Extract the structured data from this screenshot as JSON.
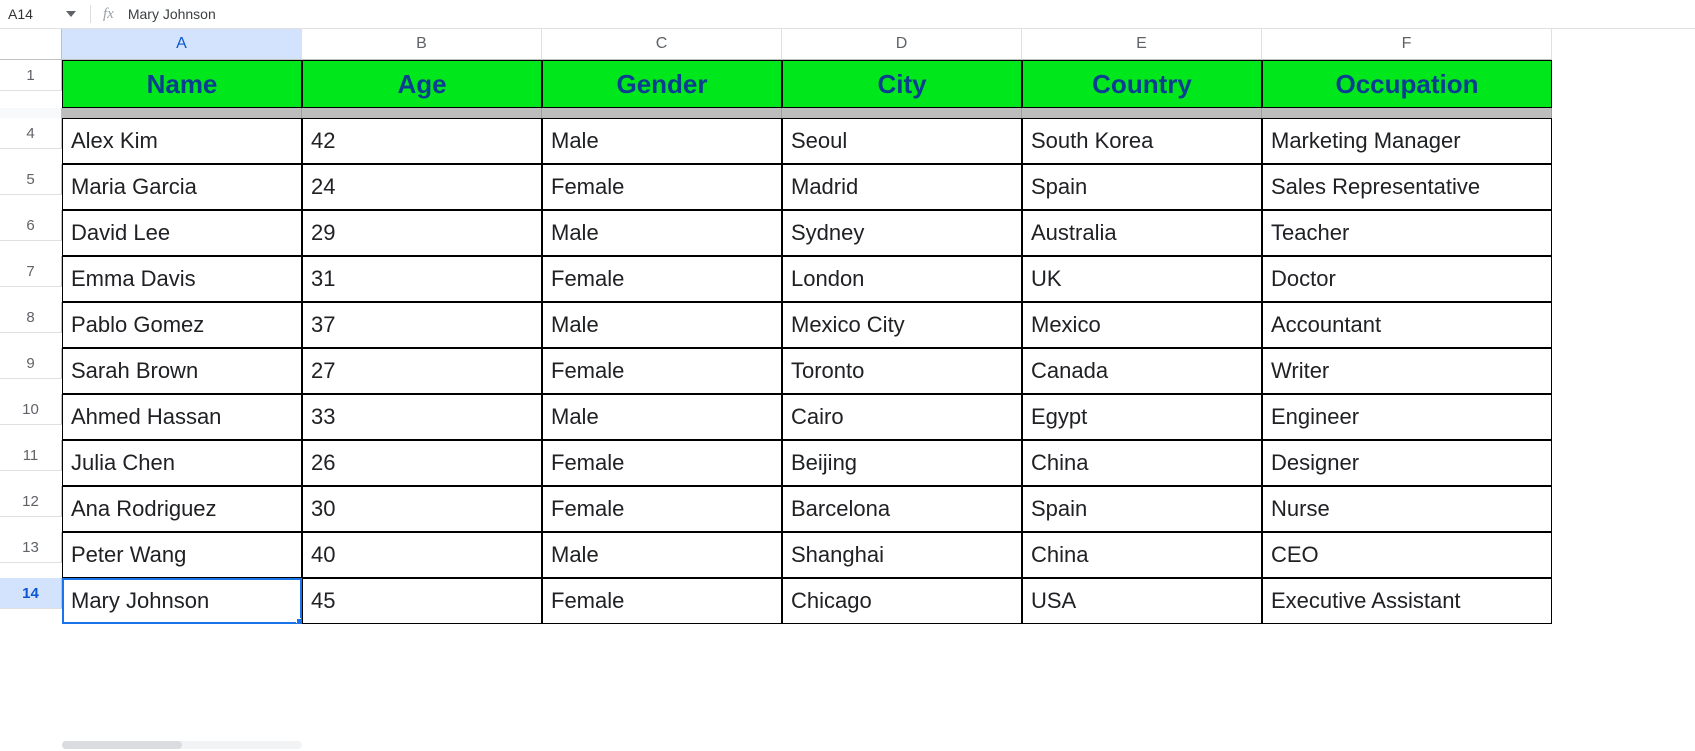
{
  "formula_bar": {
    "cell_ref": "A14",
    "fx_label": "fx",
    "content": "Mary Johnson"
  },
  "columns": [
    "A",
    "B",
    "C",
    "D",
    "E",
    "F"
  ],
  "active_column": "A",
  "active_row": "14",
  "row_numbers": [
    "1",
    "4",
    "5",
    "6",
    "7",
    "8",
    "9",
    "10",
    "11",
    "12",
    "13",
    "14"
  ],
  "table": {
    "headers": [
      "Name",
      "Age",
      "Gender",
      "City",
      "Country",
      "Occupation"
    ],
    "rows": [
      [
        "Alex Kim",
        "42",
        "Male",
        "Seoul",
        "South Korea",
        "Marketing Manager"
      ],
      [
        "Maria Garcia",
        "24",
        "Female",
        "Madrid",
        "Spain",
        "Sales Representative"
      ],
      [
        "David Lee",
        "29",
        "Male",
        "Sydney",
        "Australia",
        "Teacher"
      ],
      [
        "Emma Davis",
        "31",
        "Female",
        "London",
        "UK",
        "Doctor"
      ],
      [
        "Pablo Gomez",
        "37",
        "Male",
        "Mexico City",
        "Mexico",
        "Accountant"
      ],
      [
        "Sarah Brown",
        "27",
        "Female",
        "Toronto",
        "Canada",
        "Writer"
      ],
      [
        "Ahmed Hassan",
        "33",
        "Male",
        "Cairo",
        "Egypt",
        "Engineer"
      ],
      [
        "Julia Chen",
        "26",
        "Female",
        "Beijing",
        "China",
        "Designer"
      ],
      [
        "Ana Rodriguez",
        "30",
        "Female",
        "Barcelona",
        "Spain",
        "Nurse"
      ],
      [
        "Peter Wang",
        "40",
        "Male",
        "Shanghai",
        "China",
        "CEO"
      ],
      [
        "Mary Johnson",
        "45",
        "Female",
        "Chicago",
        "USA",
        "Executive Assistant"
      ]
    ]
  },
  "chart_data": {
    "type": "table",
    "columns": [
      "Name",
      "Age",
      "Gender",
      "City",
      "Country",
      "Occupation"
    ],
    "rows": [
      {
        "Name": "Alex Kim",
        "Age": 42,
        "Gender": "Male",
        "City": "Seoul",
        "Country": "South Korea",
        "Occupation": "Marketing Manager"
      },
      {
        "Name": "Maria Garcia",
        "Age": 24,
        "Gender": "Female",
        "City": "Madrid",
        "Country": "Spain",
        "Occupation": "Sales Representative"
      },
      {
        "Name": "David Lee",
        "Age": 29,
        "Gender": "Male",
        "City": "Sydney",
        "Country": "Australia",
        "Occupation": "Teacher"
      },
      {
        "Name": "Emma Davis",
        "Age": 31,
        "Gender": "Female",
        "City": "London",
        "Country": "UK",
        "Occupation": "Doctor"
      },
      {
        "Name": "Pablo Gomez",
        "Age": 37,
        "Gender": "Male",
        "City": "Mexico City",
        "Country": "Mexico",
        "Occupation": "Accountant"
      },
      {
        "Name": "Sarah Brown",
        "Age": 27,
        "Gender": "Female",
        "City": "Toronto",
        "Country": "Canada",
        "Occupation": "Writer"
      },
      {
        "Name": "Ahmed Hassan",
        "Age": 33,
        "Gender": "Male",
        "City": "Cairo",
        "Country": "Egypt",
        "Occupation": "Engineer"
      },
      {
        "Name": "Julia Chen",
        "Age": 26,
        "Gender": "Female",
        "City": "Beijing",
        "Country": "China",
        "Occupation": "Designer"
      },
      {
        "Name": "Ana Rodriguez",
        "Age": 30,
        "Gender": "Female",
        "City": "Barcelona",
        "Country": "Spain",
        "Occupation": "Nurse"
      },
      {
        "Name": "Peter Wang",
        "Age": 40,
        "Gender": "Male",
        "City": "Shanghai",
        "Country": "China",
        "Occupation": "CEO"
      },
      {
        "Name": "Mary Johnson",
        "Age": 45,
        "Gender": "Female",
        "City": "Chicago",
        "Country": "USA",
        "Occupation": "Executive Assistant"
      }
    ]
  },
  "colors": {
    "header_fill": "#00e81c",
    "header_text": "#0b3d91",
    "active_header_fill": "#d3e3fd",
    "selection_outline": "#1a73e8"
  }
}
